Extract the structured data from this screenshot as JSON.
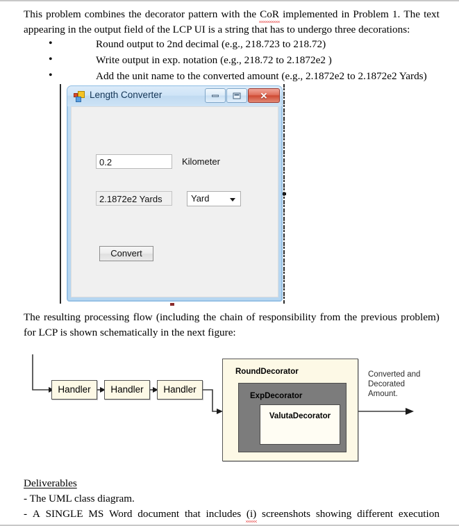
{
  "document": {
    "para1": {
      "line1_parts": [
        "This",
        "problem",
        "combines",
        "the",
        "decorator",
        "pattern",
        "with",
        "the",
        "CoR",
        "implemented",
        "in",
        "Problem",
        "1.",
        "The",
        "text"
      ],
      "misspelled_word": "CoR",
      "line2": "appearing in the output field of the LCP UI is a string that has to undergo three decorations:"
    },
    "bullets": [
      "Round output to 2nd decimal (e.g., 218.723 to 218.72)",
      "Write output in exp. notation (e.g., 218.72 to 2.1872e2 )",
      "Add the unit name to the converted amount (e.g., 2.1872e2 to 2.1872e2 Yards)"
    ],
    "para2": {
      "line1_parts": [
        "The",
        "resulting",
        "processing",
        "flow",
        "(including",
        "the",
        "chain",
        "of",
        "responsibility",
        "from",
        "the",
        "previous",
        "problem)"
      ],
      "line2": "for LCP is shown schematically in the next figure:"
    },
    "deliverables": {
      "heading": "Deliverables",
      "item1": "- The UML class diagram.",
      "item2_parts": [
        "-",
        "A",
        "SINGLE",
        "MS",
        "Word",
        "document",
        "that",
        "includes",
        "(i)",
        "screenshots",
        "showing",
        "different",
        "execution"
      ],
      "misspelled_word": "(i)"
    }
  },
  "win_form": {
    "title": "Length Converter",
    "icon": "windows-forms-icon",
    "caption_buttons": {
      "minimize": "minimize-icon",
      "maximize": "maximize-icon",
      "close": "✕"
    },
    "input_value": "0.2",
    "from_unit_label": "Kilometer",
    "output_value": "2.1872e2 Yards",
    "to_unit_selected": "Yard",
    "to_unit_options": [
      "Yard"
    ],
    "convert_button": "Convert",
    "colors": {
      "title_bar": "#cfe4f7",
      "frame": "#b6d6f1",
      "client": "#f0f0f0",
      "close_button": "#cf4a33"
    }
  },
  "diagram": {
    "handlers": [
      "Handler",
      "Handler",
      "Handler"
    ],
    "round_decorator": "RoundDecorator",
    "exp_decorator": "ExpDecorator",
    "valuta_decorator": "ValutaDecorator",
    "output_note": "Converted and\nDecorated\nAmount.",
    "colors": {
      "box_fill": "#fdf9e6",
      "exp_fill": "#7c7c7c",
      "valuta_fill": "#fffdf3",
      "stroke": "#4a4a4a"
    }
  }
}
